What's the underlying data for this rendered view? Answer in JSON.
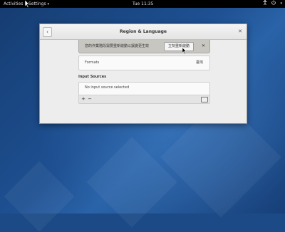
{
  "topbar": {
    "activities": "Activities",
    "app_menu": "Settings",
    "clock": "Tue 11:35"
  },
  "window": {
    "title": "Region & Language",
    "back_icon": "chevron-left-icon",
    "close_icon": "close-icon"
  },
  "infobar": {
    "message": "您的作業階段需要重新啟動以讓變更生效",
    "restart_label": "立刻重新啟動",
    "dismiss": "✕"
  },
  "formats": {
    "label": "Formats",
    "value": "臺灣"
  },
  "input_sources": {
    "heading": "Input Sources",
    "empty_text": "No input source selected",
    "add": "+",
    "remove": "−"
  }
}
